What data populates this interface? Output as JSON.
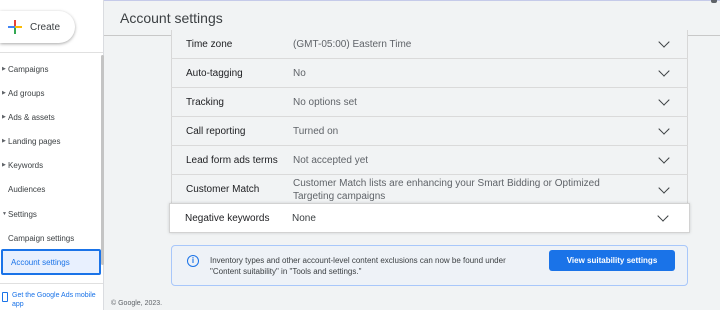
{
  "sidebar": {
    "create_label": "Create",
    "items": [
      {
        "label": "Campaigns"
      },
      {
        "label": "Ad groups"
      },
      {
        "label": "Ads & assets"
      },
      {
        "label": "Landing pages"
      },
      {
        "label": "Keywords"
      },
      {
        "label": "Audiences"
      },
      {
        "label": "Settings"
      },
      {
        "label": "Campaign settings"
      },
      {
        "label": "Account settings"
      }
    ],
    "mobile_app": "Get the Google Ads mobile app"
  },
  "header": {
    "title": "Account settings"
  },
  "settings": [
    {
      "label": "Time zone",
      "value": "(GMT-05:00) Eastern Time"
    },
    {
      "label": "Auto-tagging",
      "value": "No"
    },
    {
      "label": "Tracking",
      "value": "No options set"
    },
    {
      "label": "Call reporting",
      "value": "Turned on"
    },
    {
      "label": "Lead form ads terms",
      "value": "Not accepted yet"
    },
    {
      "label": "Customer Match",
      "value": "Customer Match lists are enhancing your Smart Bidding or Optimized Targeting campaigns"
    },
    {
      "label": "Negative keywords",
      "value": "None"
    }
  ],
  "banner": {
    "text": "Inventory types and other account-level content exclusions can now be found under \"Content suitability\" in \"Tools and settings.\"",
    "button": "View suitability settings"
  },
  "footer": {
    "copyright": "© Google, 2023."
  },
  "colors": {
    "accent": "#1a73e8",
    "active_bg": "#e8f0fe"
  }
}
